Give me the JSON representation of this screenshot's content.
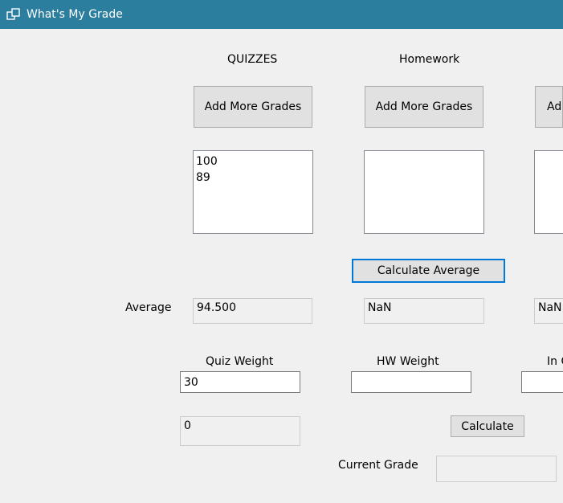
{
  "window": {
    "title": "What's My Grade",
    "icon": "app-window-icon",
    "accent_color": "#2c7e9e"
  },
  "columns": {
    "quizzes": {
      "header": "QUIZZES",
      "add_button": "Add More Grades",
      "grades": [
        "100",
        "89"
      ],
      "average": "94.500",
      "weight_label": "Quiz Weight",
      "weight_value": "30"
    },
    "homework": {
      "header": "Homework",
      "add_button": "Add More Grades",
      "grades": [],
      "average": "NaN",
      "weight_label": "HW Weight",
      "weight_value": ""
    },
    "third": {
      "add_button": "Ad",
      "average": "NaN",
      "weight_label": "In C",
      "weight_value": ""
    }
  },
  "average_label": "Average",
  "calculate_average_button": "Calculate Average",
  "weighted_result": "0",
  "calculate_button": "Calculate",
  "current_grade_label": "Current Grade",
  "current_grade_value": ""
}
